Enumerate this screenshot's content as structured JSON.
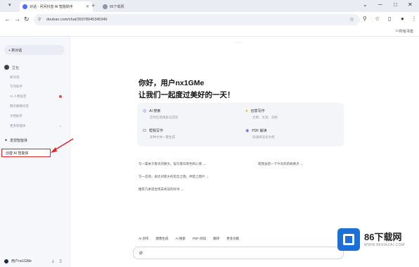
{
  "browser": {
    "tabs": [
      {
        "label": "对话 - 问问抖音 AI 智能助手"
      },
      {
        "label": "86下载网"
      }
    ],
    "url": "doubao.com/chat/39378945345346",
    "bookmarks_label": "所有书签"
  },
  "sidebar": {
    "new_chat": "+ 新对话",
    "section_user": "豆包",
    "items": [
      {
        "label": "新对话"
      },
      {
        "label": "写作助手"
      },
      {
        "label": "AI 人物设定"
      },
      {
        "label": "网页摘要问答"
      },
      {
        "label": "文档助手"
      },
      {
        "label": "更多智能体"
      }
    ],
    "discover": "发现智能体",
    "create": "创建 AI 智能体",
    "username": "用户nx1GMe"
  },
  "main": {
    "greeting_line1": "你好，用户nx1GMe",
    "greeting_line2": "让我们一起度过美好的一天！",
    "cards": [
      {
        "title": "AI 搜索",
        "subtitle": "实时信息搜索与回答"
      },
      {
        "title": "创意写作",
        "subtitle": "文章、文案、润色"
      },
      {
        "title": "帮我写作",
        "subtitle": "多种文体一键生成"
      },
      {
        "title": "PDF 解读",
        "subtitle": "快速阅读长文档"
      }
    ],
    "suggestions": [
      "写一篇关于春天的散文，描写春日景色和心情 →",
      "帮我总结一下今天的新闻要点 →",
      "写一首诗，表达对家乡的思念之情，并配上图片 →",
      "推荐几本适合周末阅读的好书 →"
    ],
    "tools": [
      "AI 创作",
      "图像生成",
      "AI 搜索",
      "PDF 阅读",
      "翻译",
      "更多功能"
    ]
  },
  "watermark": {
    "brand": "86下载网",
    "url": "WWW.86XIAZAI.COM"
  },
  "colors": {
    "accent": "#4d6bfe",
    "highlight_border": "#e0252b",
    "sidebar_bg": "#f6f7fb"
  }
}
